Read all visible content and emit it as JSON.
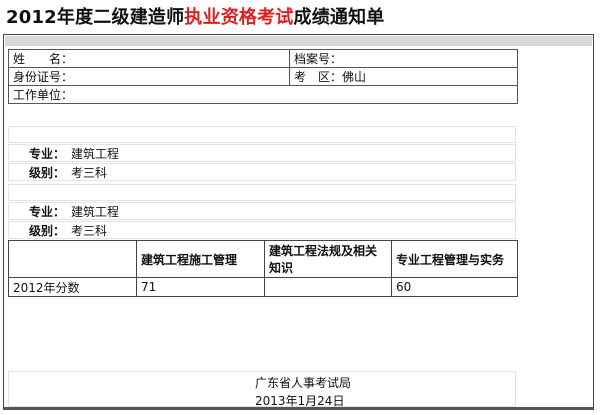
{
  "title": {
    "part1": "2012年度二级建造师",
    "part2": "执业资格考试",
    "part3": "成绩通知单"
  },
  "info": {
    "name_label": "姓　　名：",
    "name_value": "",
    "file_no_label": "档案号：",
    "file_no_value": "",
    "id_label": "身份证号：",
    "id_value": "",
    "exam_area_label": "考　区：",
    "exam_area_value": "佛山",
    "employer_label": "工作单位：",
    "employer_value": ""
  },
  "sections": [
    {
      "major_label": "专业：",
      "major_value": "建筑工程",
      "level_label": "级别：",
      "level_value": "考三科"
    },
    {
      "major_label": "专业：",
      "major_value": "建筑工程",
      "level_label": "级别：",
      "level_value": "考三科"
    }
  ],
  "scores": {
    "headers": [
      "",
      "建筑工程施工管理",
      "建筑工程法规及相关知识",
      "专业工程管理与实务"
    ],
    "row_label": "2012年分数",
    "values": [
      "71",
      "",
      "60"
    ]
  },
  "footer": {
    "issuer": "广东省人事考试局",
    "date": "2013年1月24日"
  }
}
